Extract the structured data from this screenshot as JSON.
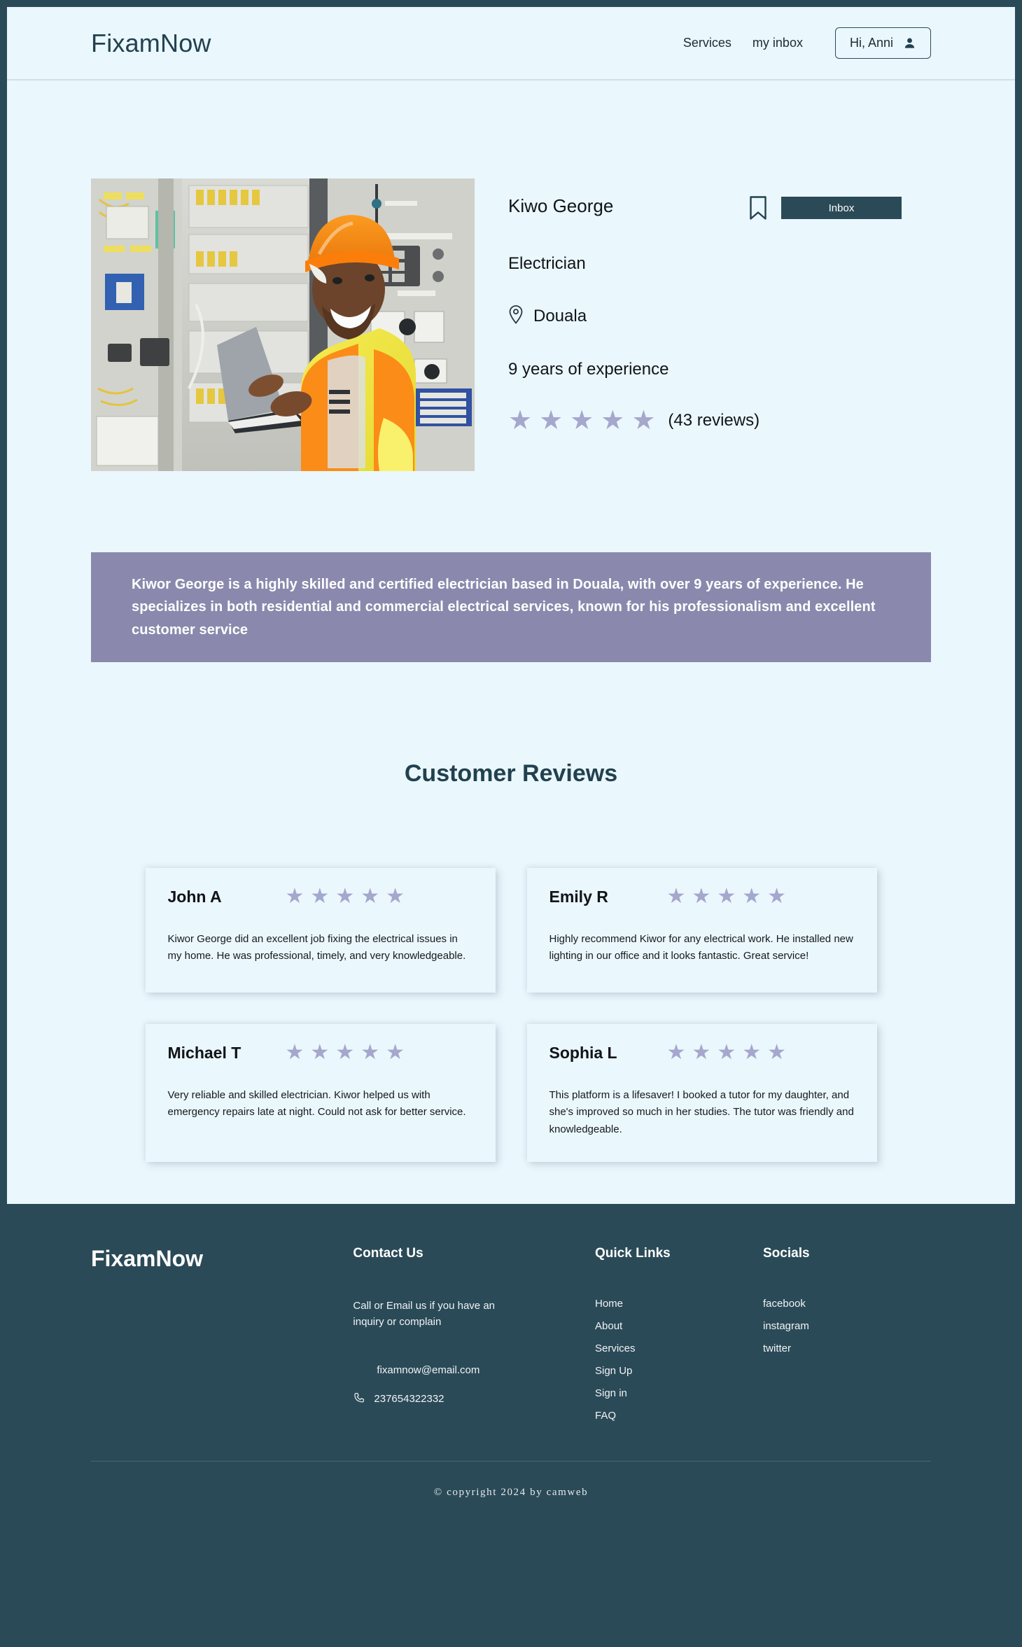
{
  "header": {
    "brand": "FixamNow",
    "nav": [
      {
        "label": "Services",
        "name": "nav-services"
      },
      {
        "label": "my inbox",
        "name": "nav-my-inbox"
      }
    ],
    "user_chip_label": "Hi, Anni"
  },
  "profile": {
    "photo_alt": "electrician-photo",
    "name": "Kiwo George",
    "profession": "Electrician",
    "location": "Douala",
    "experience": "9 years of experience",
    "rating_stars": 5,
    "review_count": "(43 reviews)",
    "bookmark_label": "bookmark",
    "inbox_button": "Inbox"
  },
  "bio": {
    "text": "Kiwor George is a highly skilled and certified electrician based in Douala, with over 9 years of experience. He specializes in both residential and commercial electrical services, known for his professionalism and excellent customer service"
  },
  "reviews": {
    "title": "Customer Reviews",
    "items": [
      {
        "author": "John A",
        "stars": 5,
        "text": "Kiwor George did an excellent job fixing the electrical issues in my home. He was professional, timely, and very knowledgeable."
      },
      {
        "author": "Emily R",
        "stars": 5,
        "text": "Highly recommend Kiwor for any electrical work. He installed new lighting in our office and it looks fantastic. Great service!"
      },
      {
        "author": "Michael T",
        "stars": 5,
        "text": "Very reliable and skilled electrician. Kiwor helped us with emergency repairs late at night. Could not ask for better service."
      },
      {
        "author": "Sophia L",
        "stars": 5,
        "text": "This platform is a lifesaver! I booked a tutor for my daughter, and she's improved so much in her studies. The tutor was friendly and knowledgeable."
      }
    ]
  },
  "footer": {
    "brand": "FixamNow",
    "contact": {
      "heading": "Contact Us",
      "description": "Call or Email us if you have an inquiry or complain",
      "email": "fixamnow@email.com",
      "phone": "237654322332"
    },
    "quick_links": {
      "heading": "Quick Links",
      "items": [
        "Home",
        "About",
        "Services",
        "Sign Up",
        "Sign in",
        "FAQ"
      ]
    },
    "socials": {
      "heading": "Socials",
      "items": [
        "facebook",
        "instagram",
        "twitter"
      ]
    },
    "copyright": "© copyright 2024 by camweb"
  },
  "colors": {
    "page_border": "#2b4a57",
    "surface": "#eaf7fd",
    "accent_dark": "#2b4a57",
    "banner_purple": "#8a89ad",
    "star": "#a6a7cd"
  }
}
